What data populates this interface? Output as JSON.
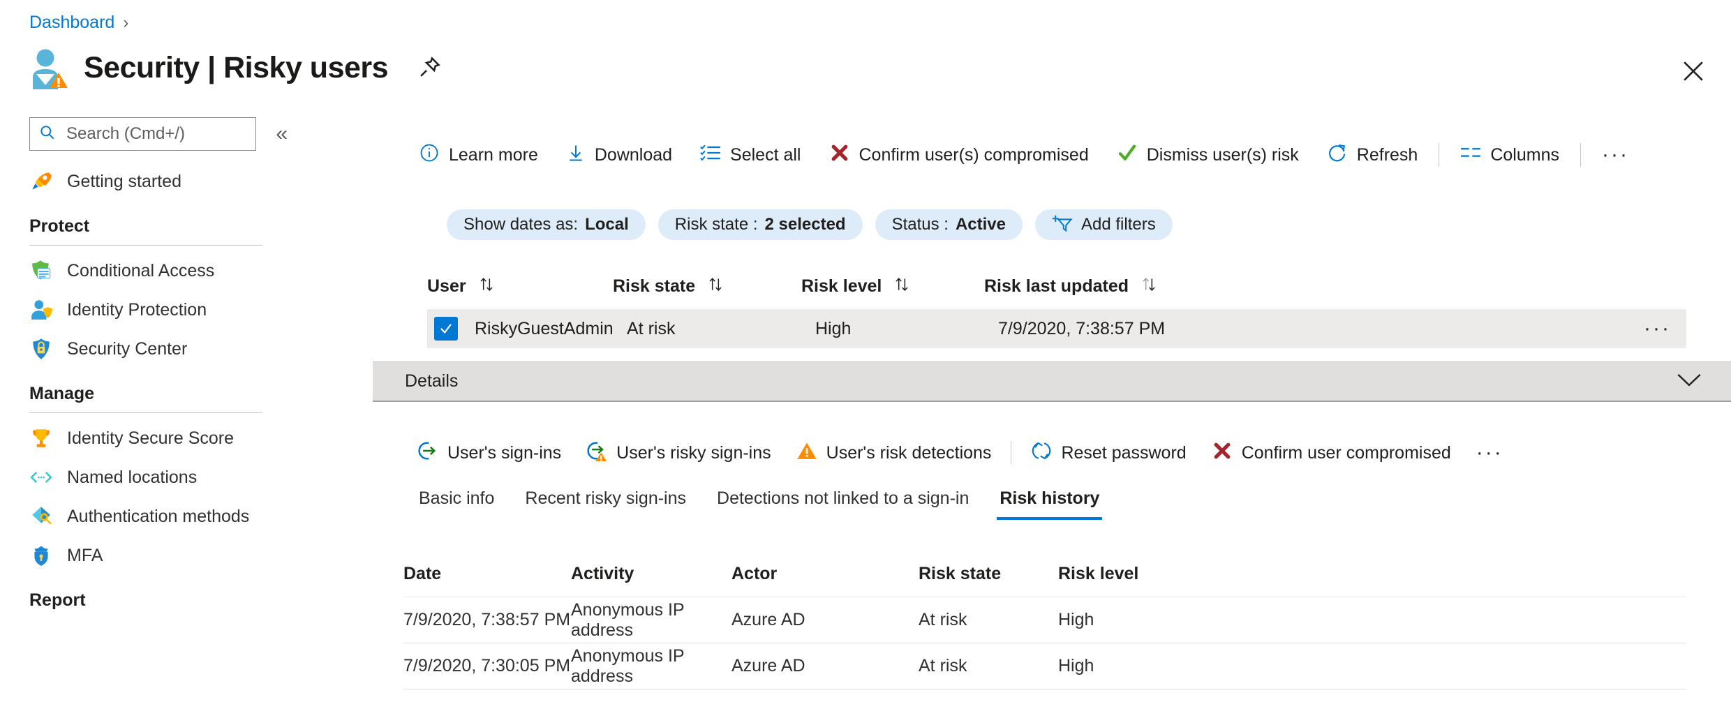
{
  "breadcrumb": {
    "items": [
      "Dashboard"
    ],
    "separator": "›"
  },
  "header": {
    "title": "Security | Risky users",
    "icon": "risky-user-icon",
    "pin_icon": "pin-icon",
    "close_icon": "close-icon"
  },
  "sidebar": {
    "search": {
      "placeholder": "Search (Cmd+/)",
      "value": "",
      "icon": "search-icon"
    },
    "collapse_icon": "«",
    "top_items": [
      {
        "label": "Getting started",
        "icon": "rocket-icon"
      }
    ],
    "groups": [
      {
        "title": "Protect",
        "items": [
          {
            "label": "Conditional Access",
            "icon": "conditional-access-icon"
          },
          {
            "label": "Identity Protection",
            "icon": "identity-protection-icon"
          },
          {
            "label": "Security Center",
            "icon": "security-center-icon"
          }
        ]
      },
      {
        "title": "Manage",
        "items": [
          {
            "label": "Identity Secure Score",
            "icon": "trophy-icon"
          },
          {
            "label": "Named locations",
            "icon": "named-locations-icon"
          },
          {
            "label": "Authentication methods",
            "icon": "authentication-methods-icon"
          },
          {
            "label": "MFA",
            "icon": "mfa-icon"
          }
        ]
      },
      {
        "title": "Report",
        "items": []
      }
    ]
  },
  "toolbar": {
    "items": [
      {
        "label": "Learn more",
        "icon": "info-icon"
      },
      {
        "label": "Download",
        "icon": "download-icon"
      },
      {
        "label": "Select all",
        "icon": "select-all-icon"
      },
      {
        "label": "Confirm user(s) compromised",
        "icon": "red-x-icon"
      },
      {
        "label": "Dismiss user(s) risk",
        "icon": "green-check-icon"
      },
      {
        "label": "Refresh",
        "icon": "refresh-icon"
      },
      {
        "label": "Columns",
        "icon": "columns-icon"
      }
    ],
    "overflow": "···"
  },
  "filters": [
    {
      "label": "Show dates as:",
      "value": "Local",
      "icon": null
    },
    {
      "label": "Risk state :",
      "value": "2 selected",
      "icon": null
    },
    {
      "label": "Status :",
      "value": "Active",
      "icon": null
    },
    {
      "label": "Add filters",
      "value": "",
      "icon": "add-filter-icon"
    }
  ],
  "users_table": {
    "columns": [
      {
        "label": "User",
        "sortable": true
      },
      {
        "label": "Risk state",
        "sortable": true
      },
      {
        "label": "Risk level",
        "sortable": true
      },
      {
        "label": "Risk last updated",
        "sortable": true
      }
    ],
    "rows": [
      {
        "selected": true,
        "user": "RiskyGuestAdmin",
        "risk_state": "At risk",
        "risk_level": "High",
        "risk_last_updated": "7/9/2020, 7:38:57 PM",
        "menu": "···"
      }
    ]
  },
  "details": {
    "label": "Details",
    "chevron_icon": "chevron-down-icon",
    "actions": [
      {
        "label": "User's sign-ins",
        "icon": "signin-icon"
      },
      {
        "label": "User's risky sign-ins",
        "icon": "risky-signin-icon"
      },
      {
        "label": "User's risk detections",
        "icon": "warning-triangle-icon"
      },
      {
        "label": "Reset password",
        "icon": "reset-password-icon"
      },
      {
        "label": "Confirm user compromised",
        "icon": "red-x-icon"
      }
    ],
    "overflow": "···",
    "tabs": [
      {
        "label": "Basic info",
        "active": false
      },
      {
        "label": "Recent risky sign-ins",
        "active": false
      },
      {
        "label": "Detections not linked to a sign-in",
        "active": false
      },
      {
        "label": "Risk history",
        "active": true
      }
    ]
  },
  "risk_history": {
    "columns": [
      "Date",
      "Activity",
      "Actor",
      "Risk state",
      "Risk level"
    ],
    "rows": [
      {
        "date": "7/9/2020, 7:38:57 PM",
        "activity": "Anonymous IP address",
        "actor": "Azure AD",
        "risk_state": "At risk",
        "risk_level": "High"
      },
      {
        "date": "7/9/2020, 7:30:05 PM",
        "activity": "Anonymous IP address",
        "actor": "Azure AD",
        "risk_state": "At risk",
        "risk_level": "High"
      }
    ]
  },
  "colors": {
    "accent": "#0078d4",
    "pill_bg": "#deecf9",
    "row_selected_bg": "#edebe9",
    "details_bg": "#e1dfdd",
    "danger": "#a4262c",
    "success": "#107c10",
    "warning": "#ff8c00"
  }
}
